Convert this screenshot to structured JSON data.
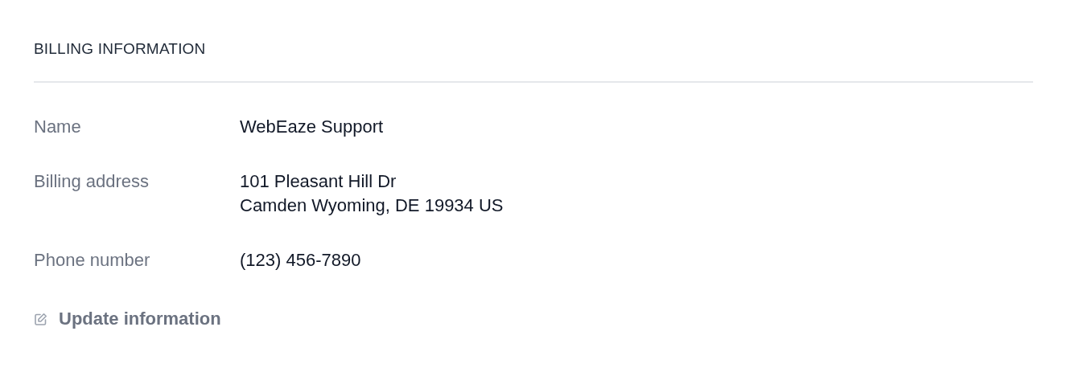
{
  "section": {
    "title": "BILLING INFORMATION"
  },
  "fields": [
    {
      "label": "Name",
      "lines": [
        "WebEaze Support"
      ]
    },
    {
      "label": "Billing address",
      "lines": [
        "101 Pleasant Hill Dr",
        "Camden Wyoming, DE 19934 US"
      ]
    },
    {
      "label": "Phone number",
      "lines": [
        "(123) 456-7890"
      ]
    }
  ],
  "action": {
    "label": "Update information"
  }
}
